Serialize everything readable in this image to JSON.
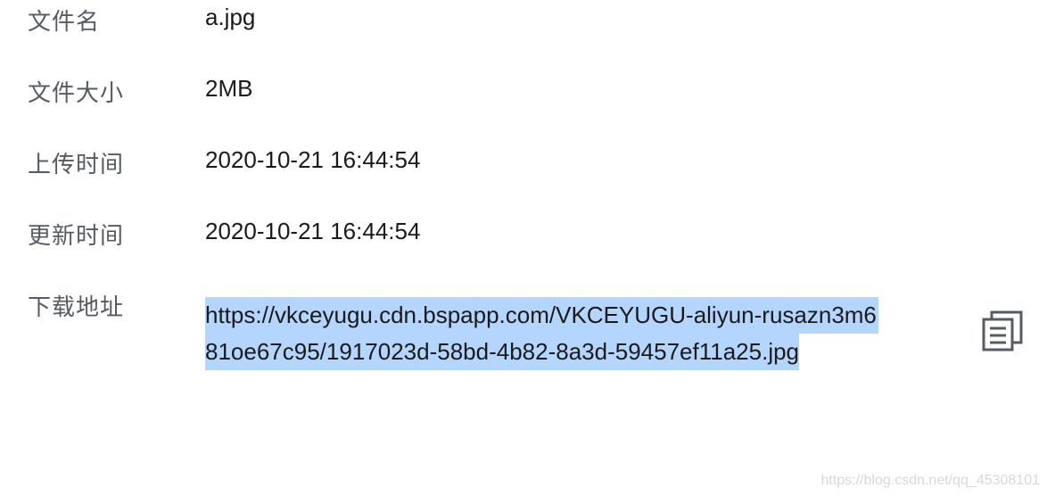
{
  "details": {
    "file_name": {
      "label": "文件名",
      "value": "a.jpg"
    },
    "file_size": {
      "label": "文件大小",
      "value": "2MB"
    },
    "upload_time": {
      "label": "上传时间",
      "value": "2020-10-21 16:44:54"
    },
    "update_time": {
      "label": "更新时间",
      "value": "2020-10-21 16:44:54"
    },
    "download_url": {
      "label": "下载地址",
      "line1": "https://vkceyugu.cdn.bspapp.com/VKCEYUGU-aliyun-rusazn3m6",
      "line2": "81oe67c95/1917023d-58bd-4b82-8a3d-59457ef11a25.jpg"
    }
  },
  "copy_button": {
    "icon": "copy-icon",
    "color": "#555b63"
  },
  "selection_color": "#b4d5fe",
  "watermark": "https://blog.csdn.net/qq_45308101"
}
